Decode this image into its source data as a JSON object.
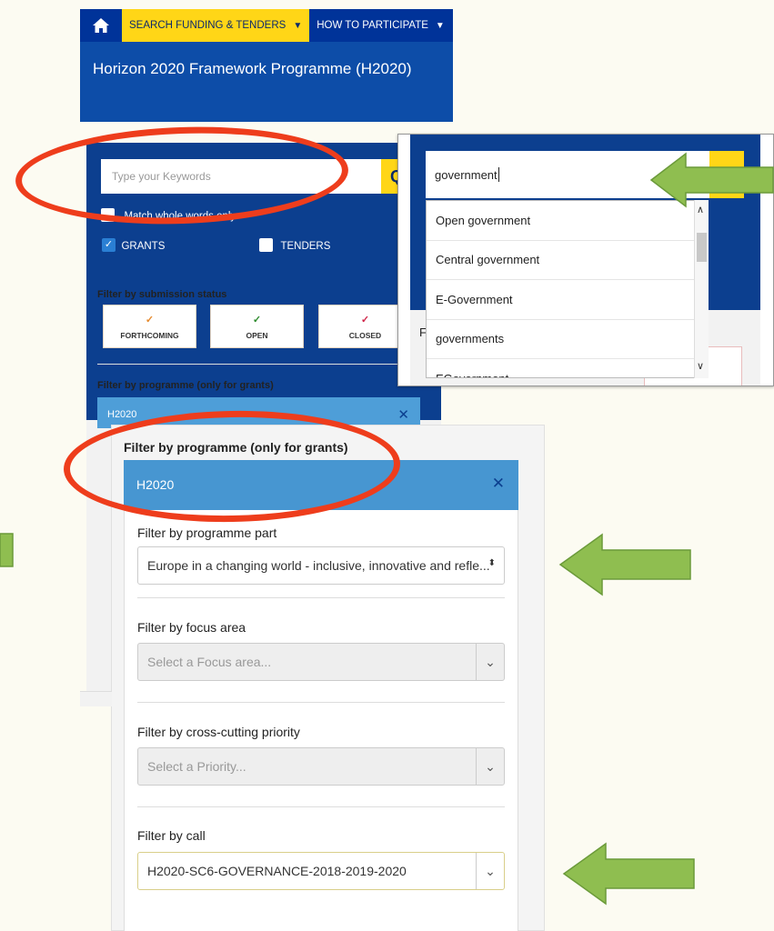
{
  "nav": {
    "items": [
      "SEARCH FUNDING & TENDERS",
      "HOW TO PARTICIPATE"
    ],
    "page_title": "Horizon 2020 Framework Programme (H2020)"
  },
  "search": {
    "placeholder": "Type your Keywords",
    "match_whole_words": "Match whole words only",
    "grants": "GRANTS",
    "tenders": "TENDERS"
  },
  "status_filter": {
    "label": "Filter by submission status",
    "options": [
      "FORTHCOMING",
      "OPEN",
      "CLOSED"
    ],
    "tick_colors": [
      "#e68a2e",
      "#2e8b2e",
      "#d0284b"
    ]
  },
  "programme_small": {
    "label": "Filter by programme (only for grants)",
    "value": "H2020"
  },
  "dropdown": {
    "query": "government",
    "suggestions": [
      "Open government",
      "Central government",
      "E-Government",
      "governments",
      "EGovernment"
    ],
    "peek_letter": "F"
  },
  "filters": {
    "programme_label": "Filter by programme (only for grants)",
    "programme_value": "H2020",
    "part_label": "Filter by programme part",
    "part_value": "Europe in a changing world - inclusive, innovative and refle...",
    "focus_label": "Filter by focus area",
    "focus_placeholder": "Select a Focus area...",
    "priority_label": "Filter by cross-cutting priority",
    "priority_placeholder": "Select a Priority...",
    "call_label": "Filter by call",
    "call_value": "H2020-SC6-GOVERNANCE-2018-2019-2020"
  },
  "colors": {
    "eu_blue": "#003399",
    "eu_yellow": "#ffd617",
    "annotation_red": "#ee3d1c",
    "annotation_green": "#8fbe50"
  }
}
